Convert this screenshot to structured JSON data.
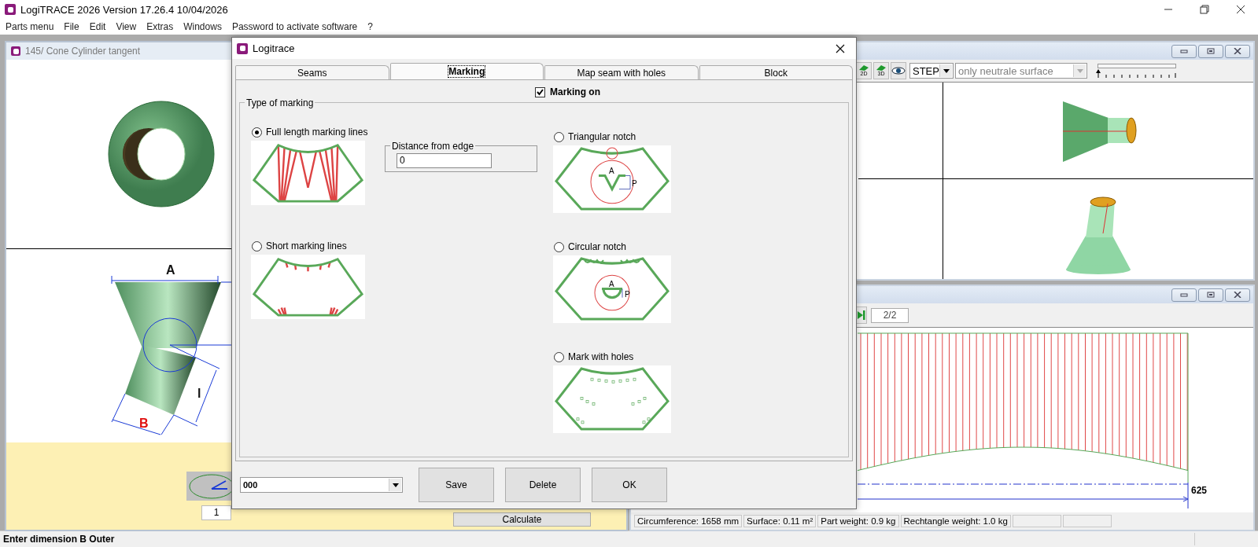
{
  "app": {
    "title": "LogiTRACE 2026  Version 17.26.4  10/04/2026"
  },
  "menu": [
    "Parts menu",
    "File",
    "Edit",
    "View",
    "Extras",
    "Windows",
    "Password to activate software",
    "?"
  ],
  "part_window": {
    "title": "145/ Cone Cylinder tangent",
    "dimension_labels": [
      {
        "text": "A",
        "active": false
      },
      {
        "text": "B",
        "active": true
      },
      {
        "text": "l",
        "active": false
      }
    ],
    "count": "1",
    "calculate_button": "Calculate"
  },
  "view_window": {
    "tool_icons": [
      "2D",
      "3D"
    ],
    "format": "STEP",
    "surface": {
      "value": "only neutrale surface",
      "disabled": true
    },
    "zoom_slider": {
      "level": 0
    }
  },
  "pattern_window": {
    "page": "2/2",
    "dimension": "625",
    "status_cells": [
      "Circumference: 1658 mm",
      "Surface: 0.11 m²",
      "Part weight: 0.9 kg",
      "Rechtangle weight: 1.0 kg"
    ]
  },
  "dialog": {
    "title": "Logitrace",
    "tabs": [
      {
        "label": "Seams",
        "selected": false
      },
      {
        "label": "Marking",
        "selected": true
      },
      {
        "label": "Map seam with holes",
        "selected": false
      },
      {
        "label": "Block",
        "selected": false
      }
    ],
    "marking_on": {
      "label": "Marking on",
      "checked": true
    },
    "group_title": "Type of marking",
    "options": [
      {
        "kind": "full",
        "label": "Full length marking lines",
        "selected": true
      },
      {
        "kind": "short",
        "label": "Short marking lines",
        "selected": false
      },
      {
        "kind": "triangular",
        "label": "Triangular notch",
        "selected": false,
        "notch_labels": [
          "A",
          "P"
        ]
      },
      {
        "kind": "circular",
        "label": "Circular notch",
        "selected": false,
        "notch_labels": [
          "A",
          "P"
        ]
      },
      {
        "kind": "holes",
        "label": "Mark with holes",
        "selected": false
      }
    ],
    "distance": {
      "label": "Distance from edge",
      "value": "0"
    },
    "preset": "000",
    "buttons": [
      "Save",
      "Delete",
      "OK"
    ]
  },
  "status_bar": {
    "message": "Enter dimension B Outer"
  }
}
